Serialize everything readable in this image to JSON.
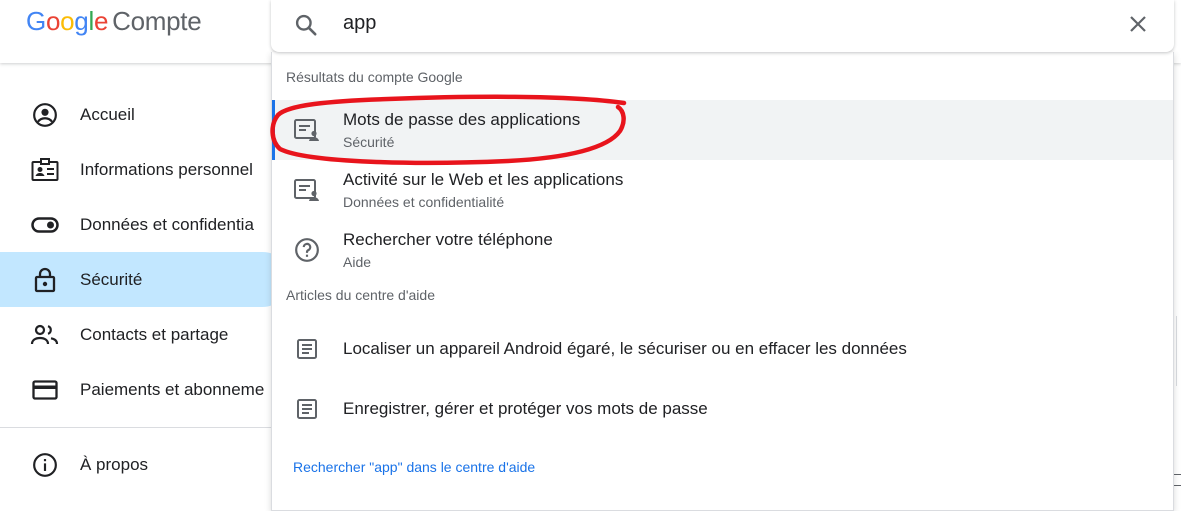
{
  "header": {
    "logo_letters": [
      "G",
      "o",
      "o",
      "g",
      "l",
      "e"
    ],
    "product": "Compte"
  },
  "search": {
    "query": "app",
    "icon": "search-icon",
    "close_icon": "close-icon"
  },
  "sidebar": {
    "items": [
      {
        "label": "Accueil",
        "icon": "account-circle-icon"
      },
      {
        "label": "Informations personnel",
        "icon": "id-card-icon"
      },
      {
        "label": "Données et confidentia",
        "icon": "toggle-icon"
      },
      {
        "label": "Sécurité",
        "icon": "lock-icon",
        "active": true
      },
      {
        "label": "Contacts et partage",
        "icon": "people-icon"
      },
      {
        "label": "Paiements et abonneme",
        "icon": "credit-card-icon"
      },
      {
        "label": "À propos",
        "icon": "info-icon"
      }
    ]
  },
  "dropdown": {
    "account_section_title": "Résultats du compte Google",
    "account_results": [
      {
        "title": "Mots de passe des applications",
        "subtitle": "Sécurité",
        "icon": "manage-accounts-icon"
      },
      {
        "title": "Activité sur le Web et les applications",
        "subtitle": "Données et confidentialité",
        "icon": "manage-accounts-icon"
      },
      {
        "title": "Rechercher votre téléphone",
        "subtitle": "Aide",
        "icon": "help-icon"
      }
    ],
    "help_section_title": "Articles du centre d'aide",
    "help_results": [
      {
        "title": "Localiser un appareil Android égaré, le sécuriser ou en effacer les données",
        "icon": "article-icon"
      },
      {
        "title": "Enregistrer, gérer et protéger vos mots de passe",
        "icon": "article-icon"
      }
    ],
    "help_link": "Rechercher \"app\" dans le centre d'aide"
  },
  "colors": {
    "active_nav": "#c2e7ff",
    "link": "#1a73e8",
    "annotation": "#e8141c"
  }
}
